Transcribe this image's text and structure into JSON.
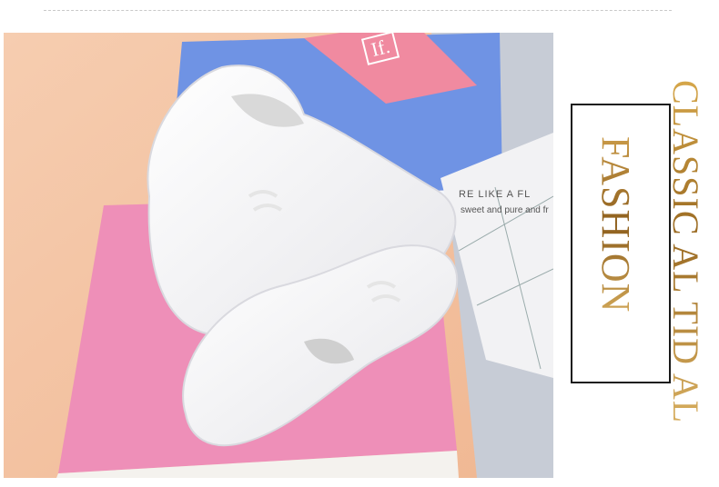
{
  "banner": {
    "headline_right": "CLASSIC AL TID AL",
    "headline_left": "FASHION"
  },
  "photo": {
    "card_logo": "If.",
    "paper_line_1": "RE LIKE A FL",
    "paper_line_2": "sweet and pure and fr"
  },
  "colors": {
    "background": "#ffffff",
    "gold_text": "#b98a3c",
    "frame": "#1a1a1a",
    "peach_backdrop": "#f3c4a4",
    "blue_box": "#6f93e4",
    "pink_box": "#ee8fb8",
    "pink_card": "#f08aa0"
  },
  "icons": [
    "sneaker-image"
  ]
}
